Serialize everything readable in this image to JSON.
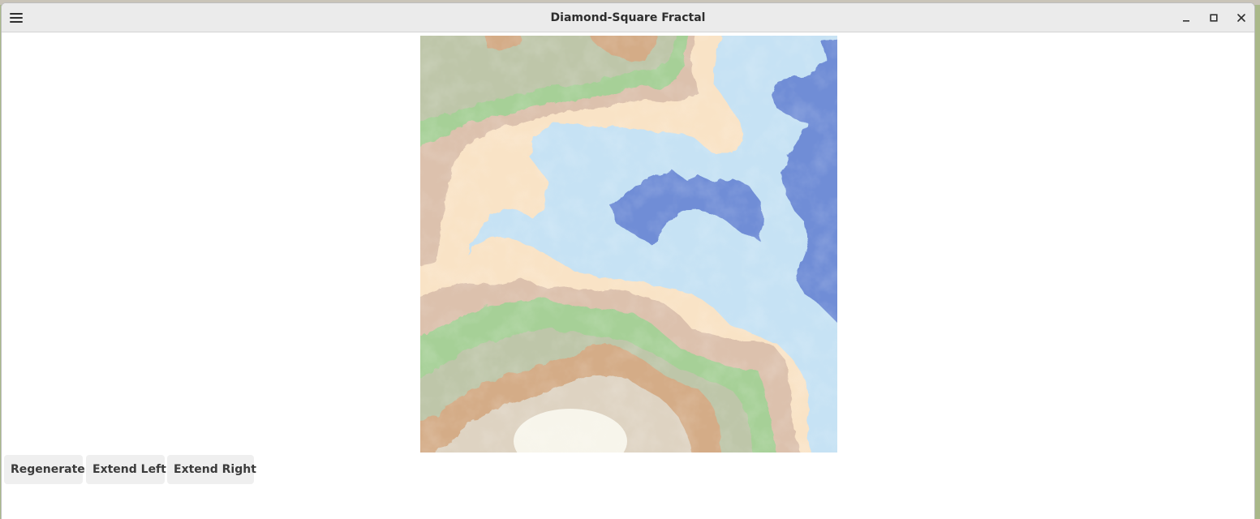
{
  "window": {
    "title": "Diamond-Square Fractal"
  },
  "icons": {
    "menu": "hamburger-menu-icon",
    "minimize": "minimize-icon",
    "maximize": "maximize-icon",
    "close": "close-icon"
  },
  "terrain_palette": {
    "deep_water": "#6f8dd6",
    "shallow_water": "#c6e2f4",
    "sand": "#f9e3c6",
    "lowland": "#dcc1ad",
    "grass": "#a6d097",
    "hill": "#bec6a9",
    "mountain": "#d4ac87",
    "rock": "#ded3c2",
    "snow": "#faf8ef"
  },
  "controls": {
    "regenerate": "Regenerate",
    "extend_left": "Extend Left",
    "extend_right": "Extend Right"
  }
}
